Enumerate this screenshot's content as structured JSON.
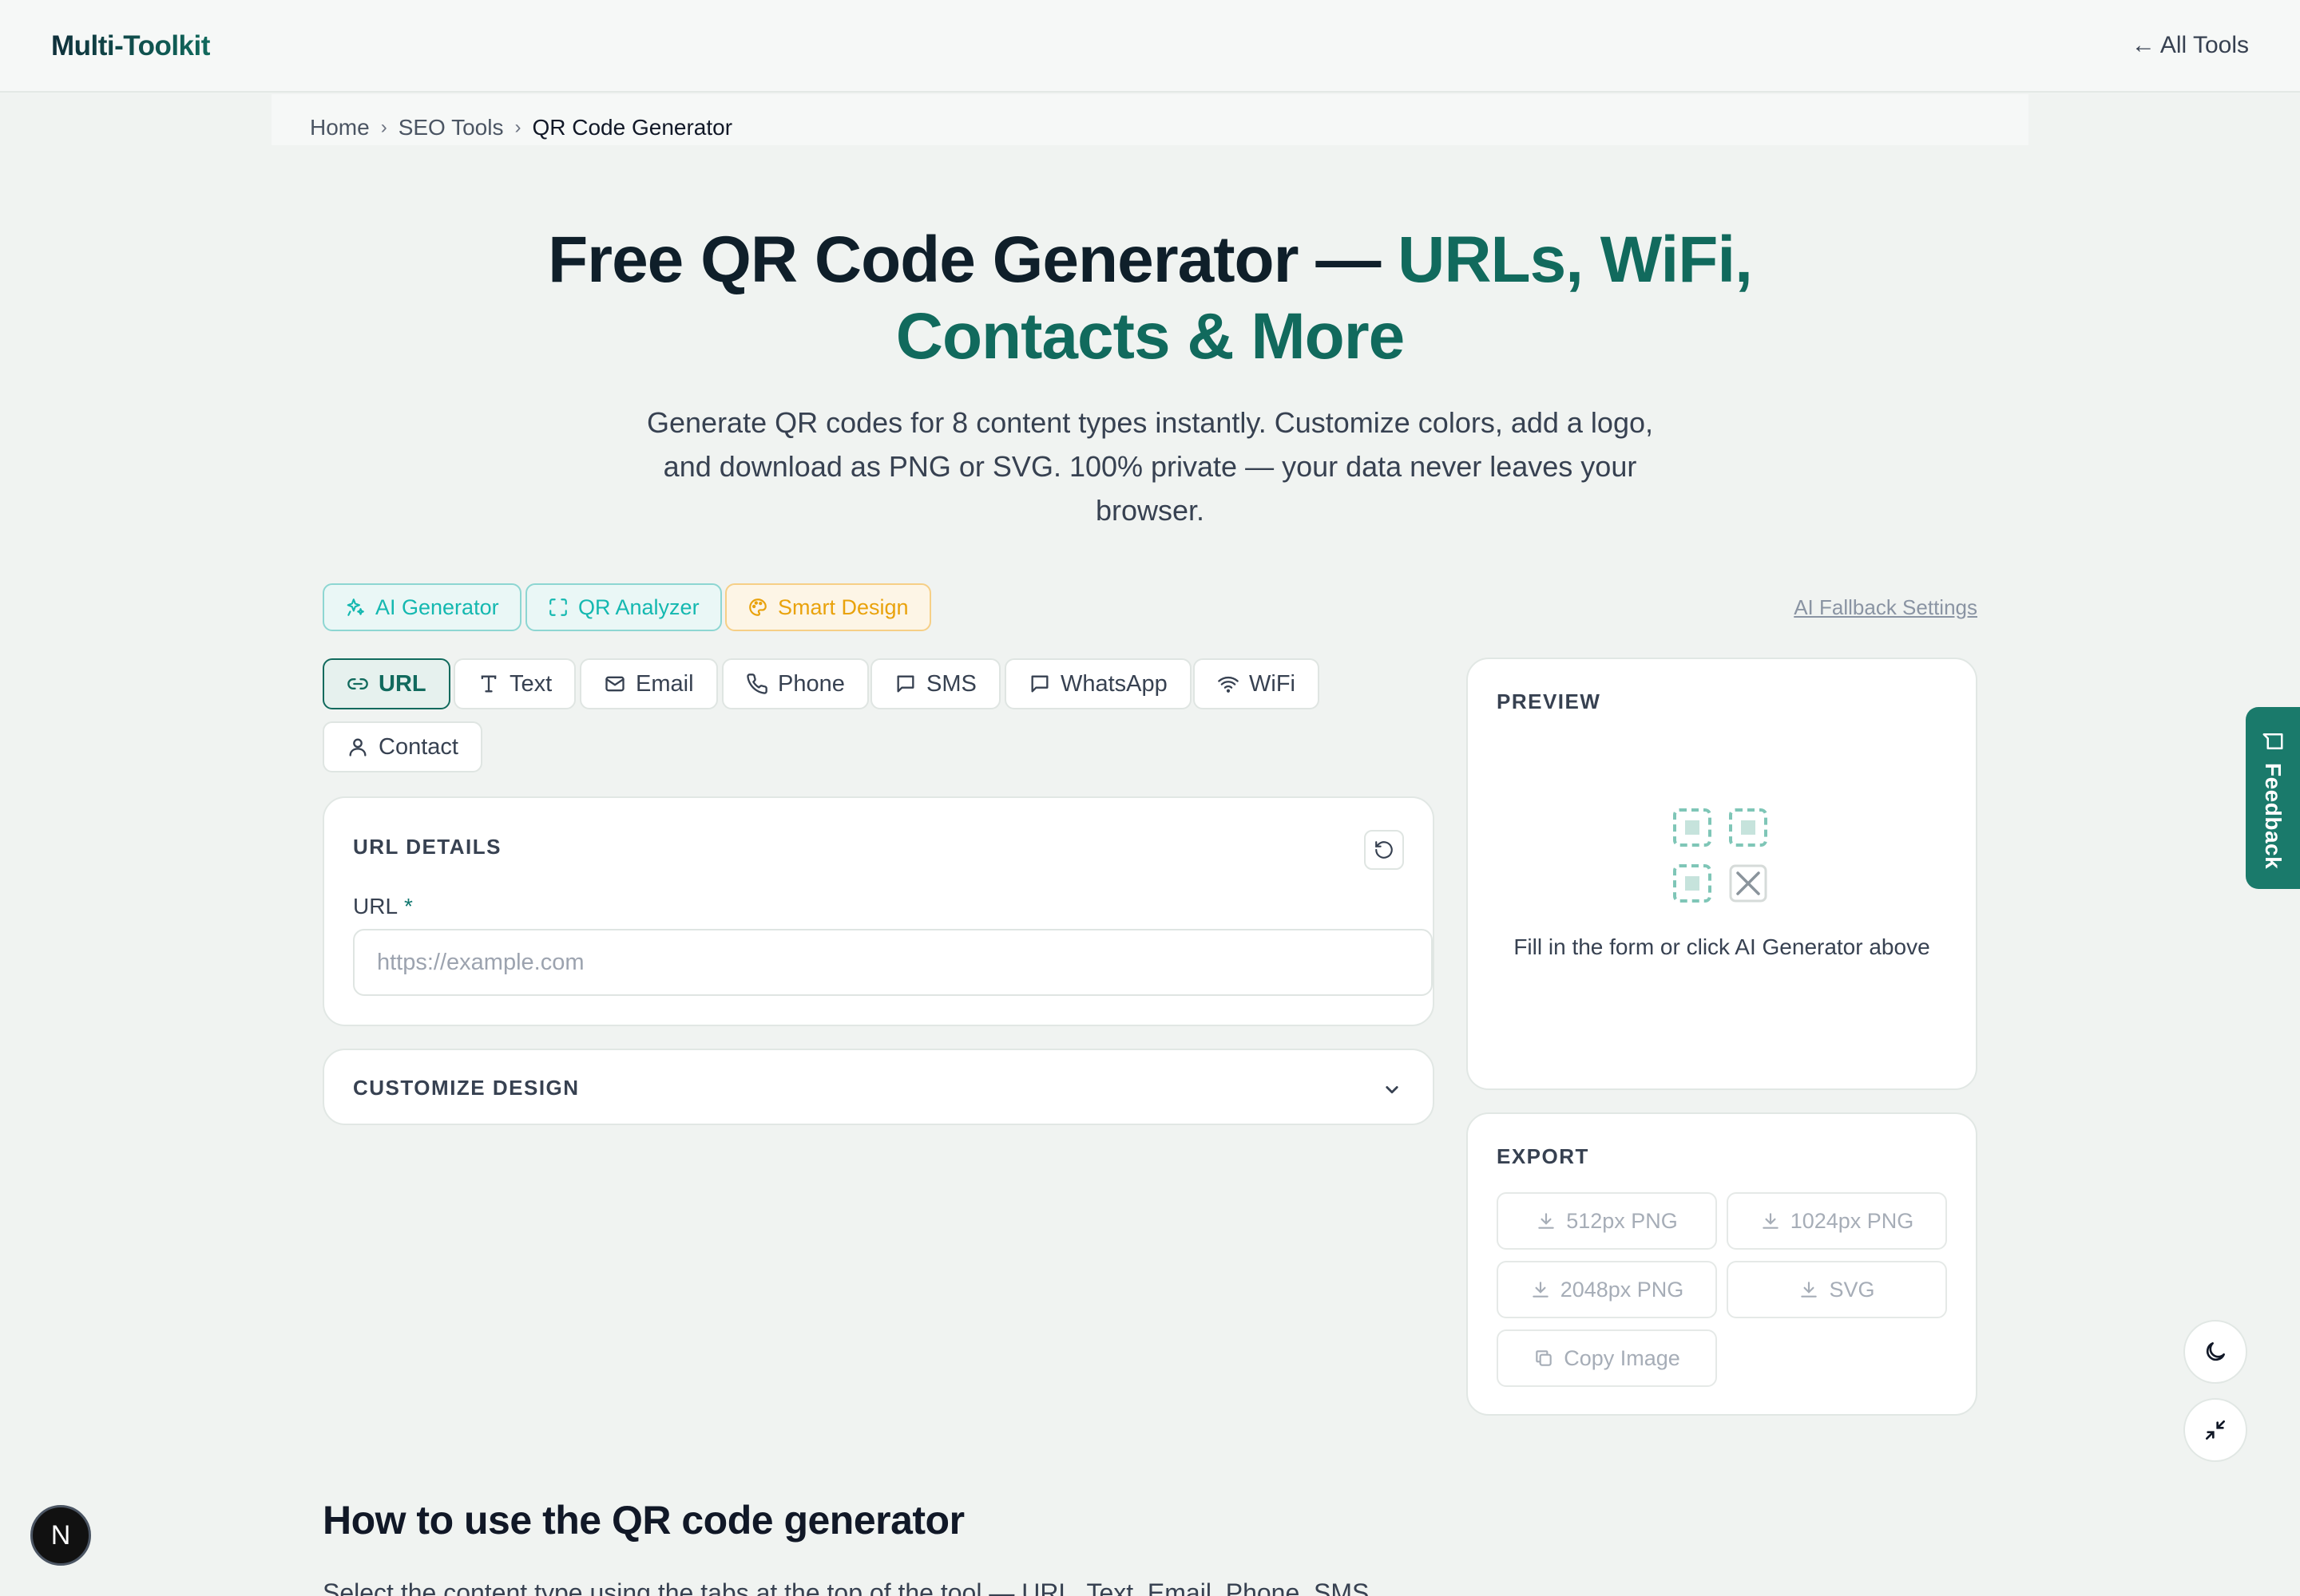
{
  "header": {
    "brand": "Multi-Toolkit",
    "all_tools": "All Tools",
    "arrow": "←"
  },
  "breadcrumb": {
    "items": [
      "Home",
      "SEO Tools",
      "QR Code Generator"
    ],
    "separator": "›"
  },
  "hero": {
    "title_part1": "Free QR Code Generator — ",
    "title_accent": "URLs, WiFi,",
    "title_line2": "Contacts & More",
    "subtitle": "Generate QR codes for 8 content types instantly. Customize colors, add a logo, and download as PNG or SVG. 100% private — your data never leaves your browser."
  },
  "features": {
    "ai_generator": "AI Generator",
    "qr_analyzer": "QR Analyzer",
    "smart_design": "Smart Design",
    "fallback_link": "AI Fallback Settings"
  },
  "tabs": {
    "url": "URL",
    "text": "Text",
    "email": "Email",
    "phone": "Phone",
    "sms": "SMS",
    "whatsapp": "WhatsApp",
    "wifi": "WiFi",
    "contact": "Contact",
    "active": "URL"
  },
  "url_details": {
    "title": "URL DETAILS",
    "field_label": "URL",
    "required_mark": "*",
    "placeholder": "https://example.com",
    "value": ""
  },
  "customize": {
    "title": "CUSTOMIZE DESIGN"
  },
  "preview": {
    "title": "PREVIEW",
    "placeholder_text": "Fill in the form or click AI Generator above"
  },
  "export": {
    "title": "EXPORT",
    "png_512": "512px PNG",
    "png_1024": "1024px PNG",
    "png_2048": "2048px PNG",
    "svg": "SVG",
    "copy": "Copy Image"
  },
  "side": {
    "feedback": "Feedback",
    "next_badge": "N"
  },
  "howto": {
    "title": "How to use the QR code generator",
    "text": "Select the content type using the tabs at the top of the tool — URL, Text, Email, Phone, SMS,"
  },
  "colors": {
    "accent": "#116a5d",
    "teal": "#14b8b0",
    "amber": "#e9a20b",
    "feedback_bg": "#1a7a6b"
  }
}
